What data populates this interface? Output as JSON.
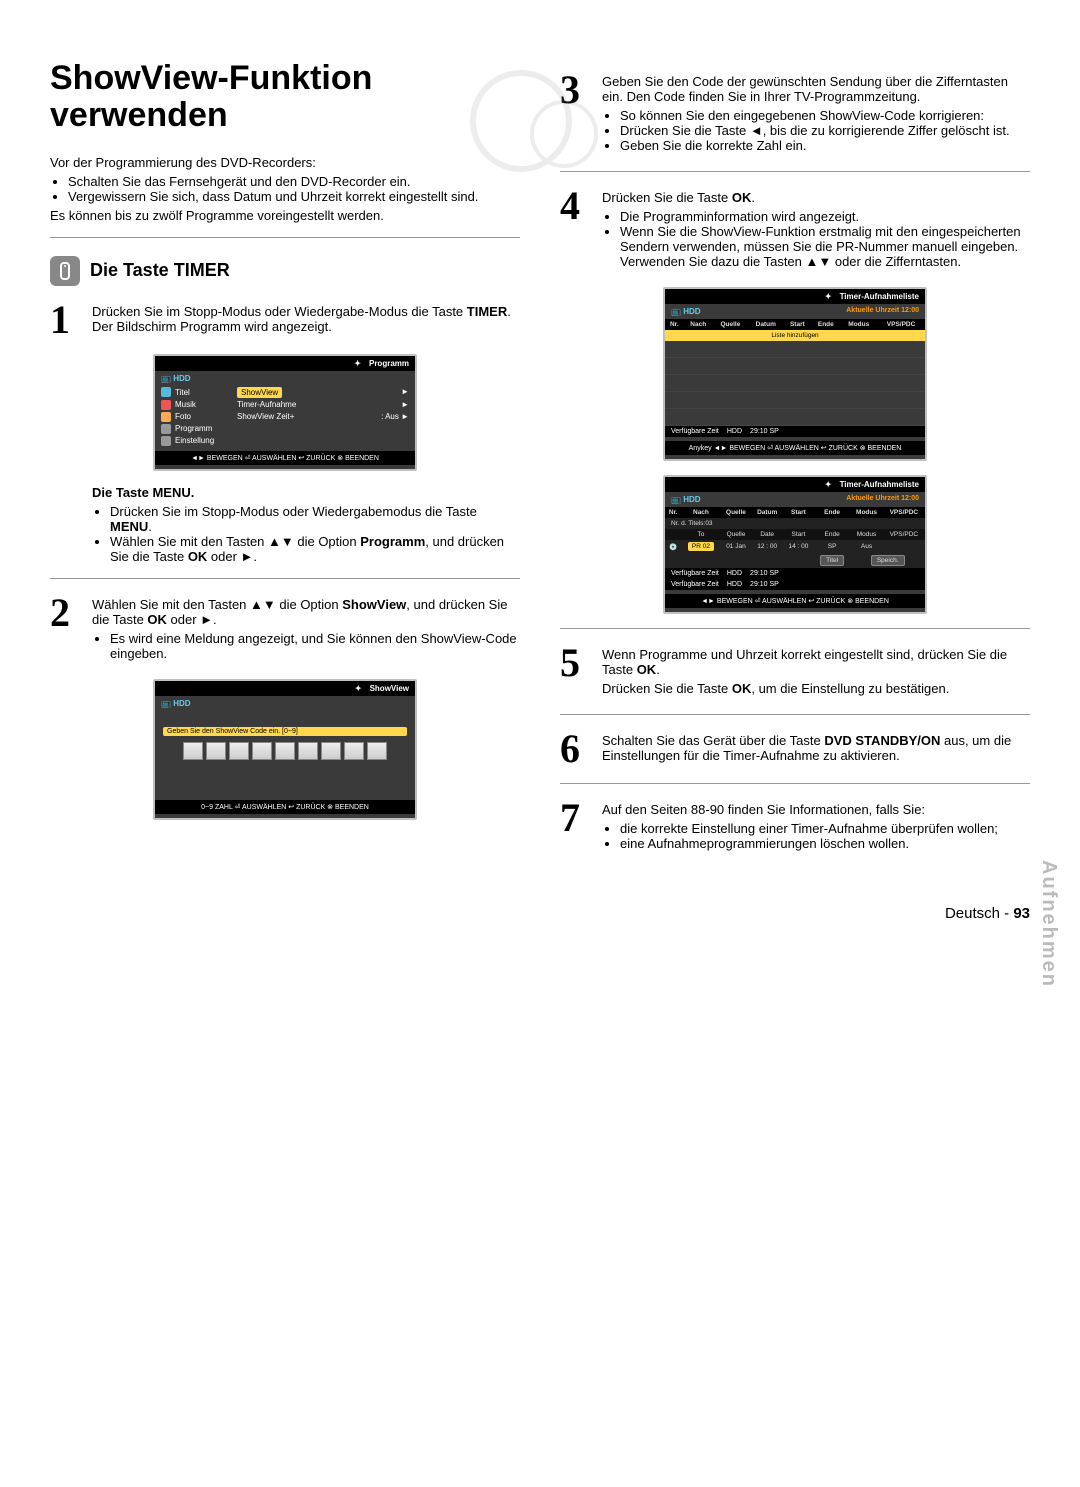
{
  "title": "ShowView-Funktion verwenden",
  "intro": {
    "lead": "Vor der Programmierung des DVD-Recorders:",
    "bullets": [
      "Schalten Sie das Fernsehgerät und den DVD-Recorder ein.",
      "Vergewissern Sie sich, dass Datum und Uhrzeit korrekt eingestellt sind."
    ],
    "tail": "Es können bis zu zwölf Programme voreingestellt werden."
  },
  "section_timer": "Die Taste TIMER",
  "step1": {
    "num": "1",
    "p1_a": "Drücken Sie im Stopp-Modus oder Wiedergabe-Modus die Taste ",
    "p1_b": "TIMER",
    "p1_c": ". Der Bildschirm Programm wird angezeigt.",
    "menu_head": "Die Taste MENU.",
    "menu_b1_a": "Drücken Sie im Stopp-Modus oder Wiedergabemodus die Taste ",
    "menu_b1_b": "MENU",
    "menu_b1_c": ".",
    "menu_b2_a": "Wählen Sie mit den Tasten ▲▼ die Option ",
    "menu_b2_b": "Programm",
    "menu_b2_c": ", und drücken Sie die Taste ",
    "menu_b2_d": "OK",
    "menu_b2_e": " oder ►."
  },
  "osd1": {
    "title": "Programm",
    "hdd": "HDD",
    "side": [
      "Titel",
      "Musik",
      "Foto",
      "Programm",
      "Einstellung"
    ],
    "items": [
      {
        "l": "ShowView",
        "r": "►"
      },
      {
        "l": "Timer-Aufnahme",
        "r": "►"
      },
      {
        "l": "ShowView Zeit+",
        "r": ": Aus        ►"
      }
    ],
    "foot": "◄► BEWEGEN  ⏎ AUSWÄHLEN  ↩ ZURÜCK  ⊗ BEENDEN"
  },
  "step2": {
    "num": "2",
    "p1_a": "Wählen Sie mit den Tasten ▲▼ die Option ",
    "p1_b": "ShowView",
    "p1_c": ", und drücken Sie die Taste ",
    "p1_d": "OK",
    "p1_e": " oder ►.",
    "b1": "Es wird eine Meldung angezeigt, und Sie können den ShowView-Code eingeben."
  },
  "osd2": {
    "title": "ShowView",
    "hdd": "HDD",
    "prompt": "Geben Sie den ShowView Code ein. [0~9]",
    "foot": "0~9 ZAHL  ⏎ AUSWÄHLEN  ↩ ZURÜCK  ⊗ BEENDEN"
  },
  "step3": {
    "num": "3",
    "p1": "Geben Sie den Code der gewünschten Sendung über die Zifferntasten ein. Den Code finden Sie in Ihrer TV-Programmzeitung.",
    "b1": "So können Sie den eingegebenen ShowView-Code korrigieren:",
    "b2": "Drücken Sie die Taste ◄, bis die zu korrigierende Ziffer gelöscht ist.",
    "b3": "Geben Sie die korrekte Zahl ein."
  },
  "step4": {
    "num": "4",
    "p1_a": "Drücken Sie die Taste ",
    "p1_b": "OK",
    "p1_c": ".",
    "b1": "Die Programminformation wird angezeigt.",
    "b2": "Wenn Sie die ShowView-Funktion erstmalig mit den eingespeicherten Sendern verwenden, müssen Sie die PR-Nummer manuell eingeben. Verwenden Sie dazu die Tasten ▲▼ oder die Zifferntasten."
  },
  "osd3": {
    "title": "Timer-Aufnahmeliste",
    "hdd": "HDD",
    "clock": "Aktuelle Uhrzeit 12:00",
    "cols": [
      "Nr.",
      "Nach",
      "Quelle",
      "Datum",
      "Start",
      "Ende",
      "Modus",
      "VPS/PDC"
    ],
    "add": "Liste hinzufügen",
    "avail_label": "Verfügbare Zeit",
    "avail_hdd": "HDD",
    "avail_val": "29:10 SP",
    "foot": "Anykey  ◄► BEWEGEN  ⏎ AUSWÄHLEN  ↩ ZURÜCK  ⊗ BEENDEN"
  },
  "osd4": {
    "title": "Timer-Aufnahmeliste",
    "hdd": "HDD",
    "clock": "Aktuelle Uhrzeit 12:00",
    "cols": [
      "Nr.",
      "Nach",
      "Quelle",
      "Datum",
      "Start",
      "Ende",
      "Modus",
      "VPS/PDC"
    ],
    "nrline": "Nr. d. Titels:03",
    "sub_cols": [
      "To",
      "Quelle",
      "Date",
      "Start",
      "Ende",
      "Modus",
      "VPS/PDC"
    ],
    "row": [
      "",
      "PR 02",
      "01 Jan",
      "12 : 00",
      "14 : 00",
      "SP",
      "Aus"
    ],
    "btn_title": "Titel",
    "btn_save": "Speich.",
    "avail1_label": "Verfügbare Zeit",
    "avail1_hdd": "HDD",
    "avail1_val": "29:10 SP",
    "avail2_label": "Verfügbare Zeit",
    "avail2_hdd": "HDD",
    "avail2_val": "29:10 SP",
    "foot": "◄► BEWEGEN  ⏎ AUSWÄHLEN  ↩ ZURÜCK  ⊗ BEENDEN"
  },
  "step5": {
    "num": "5",
    "p1_a": "Wenn Programme und Uhrzeit korrekt eingestellt sind, drücken Sie die Taste ",
    "p1_b": "OK",
    "p1_c": ".",
    "p2_a": "Drücken Sie die Taste ",
    "p2_b": "OK",
    "p2_c": ", um die Einstellung zu bestätigen."
  },
  "step6": {
    "num": "6",
    "p1_a": "Schalten Sie das Gerät über die Taste ",
    "p1_b": "DVD STANDBY/ON",
    "p1_c": " aus, um die Einstellungen für die Timer-Aufnahme zu aktivieren."
  },
  "step7": {
    "num": "7",
    "p1": "Auf den Seiten 88-90 finden Sie Informationen, falls Sie:",
    "b1": "die korrekte Einstellung einer Timer-Aufnahme überprüfen wollen;",
    "b2": "eine Aufnahmeprogrammierungen löschen wollen."
  },
  "side_tab": "Aufnehmen",
  "footer_lang": "Deutsch - ",
  "footer_page": "93"
}
